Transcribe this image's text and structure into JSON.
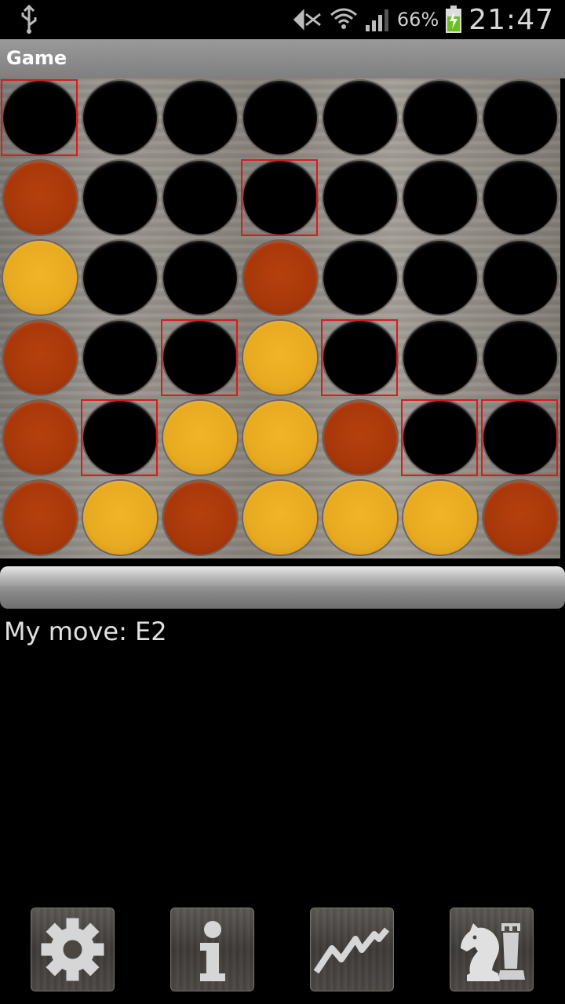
{
  "statusbar": {
    "battery_percent": "66%",
    "time": "21:47"
  },
  "titlebar": {
    "title": "Game"
  },
  "board": {
    "columns": 7,
    "rows": 6,
    "grid": [
      [
        "empty",
        "empty",
        "empty",
        "empty",
        "empty",
        "empty",
        "empty"
      ],
      [
        "red",
        "empty",
        "empty",
        "empty",
        "empty",
        "empty",
        "empty"
      ],
      [
        "yellow",
        "empty",
        "empty",
        "red",
        "empty",
        "empty",
        "empty"
      ],
      [
        "red",
        "empty",
        "empty",
        "yellow",
        "empty",
        "empty",
        "empty"
      ],
      [
        "red",
        "empty",
        "yellow",
        "yellow",
        "red",
        "empty",
        "empty"
      ],
      [
        "red",
        "yellow",
        "red",
        "yellow",
        "yellow",
        "yellow",
        "red"
      ]
    ],
    "highlighted_cells": [
      [
        0,
        0
      ],
      [
        1,
        3
      ],
      [
        3,
        2
      ],
      [
        3,
        4
      ],
      [
        4,
        1
      ],
      [
        4,
        5
      ],
      [
        4,
        6
      ]
    ],
    "colors": {
      "red": "#a8380a",
      "yellow": "#e8aa20",
      "highlight": "#e01818"
    }
  },
  "message": "My move: E2",
  "toolbar": [
    {
      "icon": "gear-icon"
    },
    {
      "icon": "info-icon"
    },
    {
      "icon": "chart-icon"
    },
    {
      "icon": "chess-pieces-icon"
    }
  ]
}
